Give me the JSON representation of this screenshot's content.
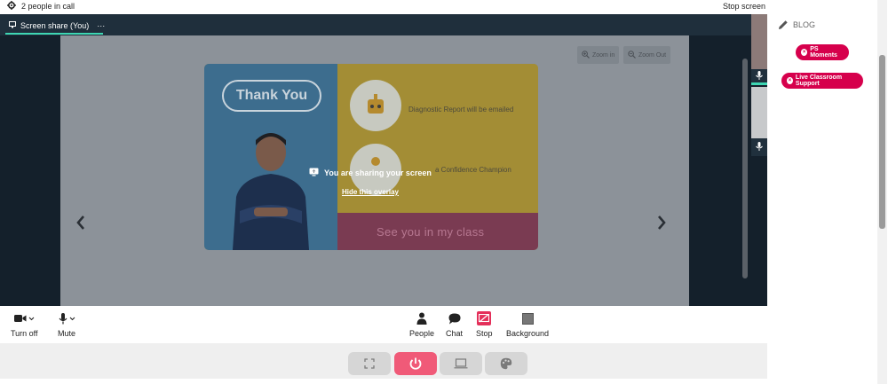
{
  "topbar": {
    "people_count": "2 people in call",
    "stop_screen": "Stop screen"
  },
  "tab": {
    "label": "Screen share (You)",
    "more": "···"
  },
  "zoom": {
    "zoom_in": "Zoom in",
    "zoom_out": "Zoom Out"
  },
  "slide": {
    "thank_you": "Thank You",
    "line1": "Diagnostic Report will be emailed",
    "line2": "a Confidence Champion",
    "footer": "See you in my class"
  },
  "overlay": {
    "message": "You are sharing your screen",
    "hide": "Hide this overlay"
  },
  "controls": {
    "turn_off": "Turn off",
    "mute": "Mute",
    "people": "People",
    "chat": "Chat",
    "stop": "Stop",
    "background": "Background"
  },
  "sidebar": {
    "blog": "BLOG",
    "pill1": "PS Moments",
    "pill2": "Live Classroom Support"
  },
  "colors": {
    "accent": "#3ed6b3",
    "stop_red": "#e4305a",
    "pill_red": "#d6004c",
    "power": "#f05a78"
  }
}
